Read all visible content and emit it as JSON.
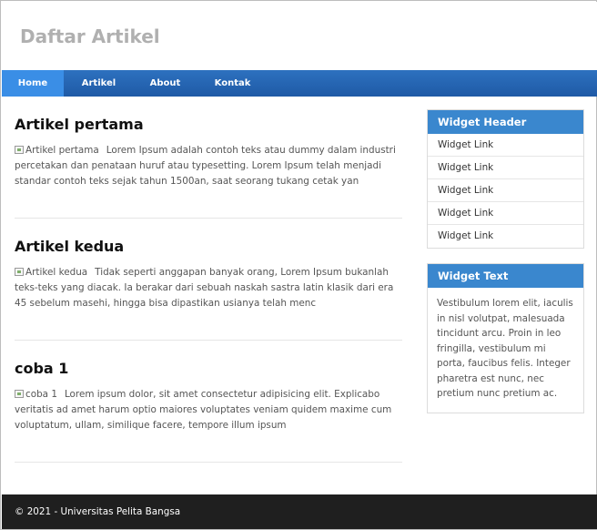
{
  "site": {
    "title": "Daftar Artikel"
  },
  "nav": {
    "items": [
      {
        "label": "Home",
        "active": true
      },
      {
        "label": "Artikel",
        "active": false
      },
      {
        "label": "About",
        "active": false
      },
      {
        "label": "Kontak",
        "active": false
      }
    ]
  },
  "articles": [
    {
      "title": "Artikel pertama",
      "image_alt": "Artikel pertama",
      "excerpt": "Lorem Ipsum adalah contoh teks atau dummy dalam industri percetakan dan penataan huruf atau typesetting. Lorem Ipsum telah menjadi standar contoh teks sejak tahun 1500an, saat seorang tukang cetak yan"
    },
    {
      "title": "Artikel kedua",
      "image_alt": "Artikel kedua",
      "excerpt": "Tidak seperti anggapan banyak orang, Lorem Ipsum bukanlah teks-teks yang diacak. Ia berakar dari sebuah naskah sastra latin klasik dari era 45 sebelum masehi, hingga bisa dipastikan usianya telah menc"
    },
    {
      "title": "coba 1",
      "image_alt": "coba 1",
      "excerpt": "Lorem ipsum dolor, sit amet consectetur adipisicing elit. Explicabo veritatis ad amet harum optio maiores voluptates veniam quidem maxime cum voluptatum, ullam, similique facere, tempore illum ipsum"
    }
  ],
  "sidebar": {
    "links_widget": {
      "header": "Widget Header",
      "links": [
        "Widget Link",
        "Widget Link",
        "Widget Link",
        "Widget Link",
        "Widget Link"
      ]
    },
    "text_widget": {
      "header": "Widget Text",
      "body": "Vestibulum lorem elit, iaculis in nisl volutpat, malesuada tincidunt arcu. Proin in leo fringilla, vestibulum mi porta, faucibus felis. Integer pharetra est nunc, nec pretium nunc pretium ac."
    }
  },
  "footer": {
    "text": "© 2021 - Universitas Pelita Bangsa"
  },
  "colors": {
    "nav": "#1f5aa6",
    "nav_active": "#3a8ee6",
    "widget_header": "#3a87ce",
    "footer": "#1f1f1f",
    "site_title": "#b0b0b0"
  }
}
